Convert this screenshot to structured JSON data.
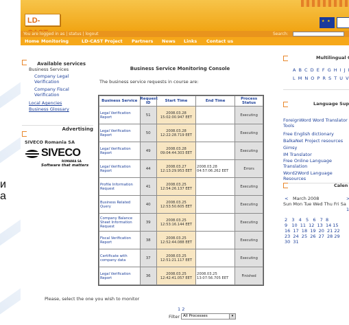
{
  "background_fragments": [
    "и",
    "а"
  ],
  "header": {
    "logo_ld": "LD",
    "logo_cast": "-CAST",
    "login_status": "You are logged in as | status | logout",
    "search_label": "Search:",
    "search_value": ""
  },
  "nav": [
    "Home",
    "Monitoring",
    "LD-CAST Project",
    "Partners",
    "News",
    "Links",
    "Contact us"
  ],
  "left": {
    "services_title": "Available services",
    "business_services": "Business Services",
    "company_legal": "Company Legal Verification",
    "company_fiscal": "Company Fiscal Verification",
    "local_agencies": "Local Agencies",
    "business_glossary": "Business Glossary",
    "advertising_title": "Advertising",
    "ad_company": "SIVECO Romania SA",
    "ad_logo_text": "SIVECO",
    "ad_logo_sub": "ROMANIA SA",
    "ad_tagline": "Software that matters"
  },
  "main": {
    "title": "Business Service Monitoring Console",
    "intro": "The business service requests in course are:",
    "headers": [
      "Business Service",
      "Request ID",
      "Start Time",
      "End Time",
      "Process Status"
    ],
    "rows": [
      {
        "service": "Legal Verification Report",
        "id": "51",
        "start": "2008.03.28 15:02:00.947 EET",
        "end": "",
        "status": "Executing"
      },
      {
        "service": "Legal Verification Report",
        "id": "50",
        "start": "2008.03.28 12:22:28.719 EET",
        "end": "",
        "status": "Executing"
      },
      {
        "service": "Legal Verification Report",
        "id": "49",
        "start": "2008.03.28 09:04:44.303 EET",
        "end": "",
        "status": "Executing"
      },
      {
        "service": "Legal Verification Report",
        "id": "44",
        "start": "2008.03.27 12:13:29.953 EET",
        "end": "2008.03.28 04:57:06.262 EET",
        "status": "Errors"
      },
      {
        "service": "Profile Information Request",
        "id": "41",
        "start": "2008.03.25 12:54:26.137 EET",
        "end": "",
        "status": "Executing"
      },
      {
        "service": "Business Related Query",
        "id": "40",
        "start": "2008.03.25 12:53:50.605 EET",
        "end": "",
        "status": "Executing"
      },
      {
        "service": "Company Balance Sheet Information Request",
        "id": "39",
        "start": "2008.03.25 12:53:16.144 EET",
        "end": "",
        "status": "Executing"
      },
      {
        "service": "Fiscal Verification Report",
        "id": "38",
        "start": "2008.03.25 12:52:44.088 EET",
        "end": "",
        "status": "Executing"
      },
      {
        "service": "Certificate with company data",
        "id": "37",
        "start": "2008.03.25 12:51:21.117 EET",
        "end": "",
        "status": "Executing"
      },
      {
        "service": "Legal Verification Report",
        "id": "36",
        "start": "2008.03.25 12:42:41.057 EET",
        "end": "2008.03.25 13:07:56.705 EET",
        "status": "Finished"
      }
    ],
    "select_msg": "Please, select the one you wish to monitor",
    "pages": "1 2",
    "filter_label": "Filter",
    "filter_value": "All Processes"
  },
  "right": {
    "glossary_title": "Multilingual Glossa",
    "letters_1": "A B C D E F G H I J K",
    "letters_2": "L M N O P R S T U V X Z",
    "language_title": "Language Suppo",
    "lang_links": [
      "ForeignWord Word Translator Tools",
      "Free English dictionary",
      "BalkaNet Project resources",
      "Gimsy",
      "IM Translator",
      "Free Online Language Translation",
      "Word2Word Language Resources"
    ],
    "calendar_title": "Calen",
    "cal_prev": "<",
    "cal_month": "March 2008",
    "cal_next": ">",
    "cal_days": "Sun Mon Tue Wed Thu Fri Sa",
    "cal_week0": "1",
    "cal_week1": "2   3   4   5   6   7  8",
    "cal_week2": "9   10  11  12  13  14 15",
    "cal_week3": "16  17  18  19  20  21 22",
    "cal_week4": "23  24  25  26  27  28 29",
    "cal_week5": "30  31"
  }
}
